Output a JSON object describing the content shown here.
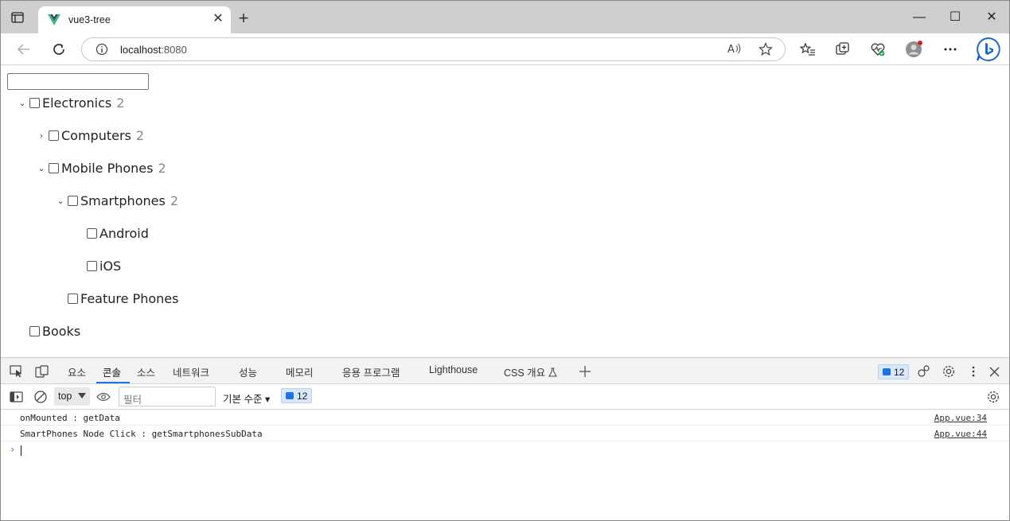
{
  "browser": {
    "tab_title": "vue3-tree",
    "tab_close": "✕",
    "new_tab": "+",
    "window_controls": {
      "minimize": "—",
      "maximize": "☐",
      "close": "✕"
    },
    "address": {
      "host": "localhost",
      "port": ":8080"
    }
  },
  "page": {
    "filter_value": "",
    "tree": [
      {
        "label": "Electronics",
        "count": "2",
        "arrow": "⌄",
        "checked": false
      },
      {
        "label": "Computers",
        "count": "2",
        "arrow": "›",
        "checked": false
      },
      {
        "label": "Mobile Phones",
        "count": "2",
        "arrow": "⌄",
        "checked": false
      },
      {
        "label": "Smartphones",
        "count": "2",
        "arrow": "⌄",
        "checked": false
      },
      {
        "label": "Android",
        "count": "",
        "arrow": "",
        "checked": false
      },
      {
        "label": "iOS",
        "count": "",
        "arrow": "",
        "checked": false
      },
      {
        "label": "Feature Phones",
        "count": "",
        "arrow": "",
        "checked": false
      },
      {
        "label": "Books",
        "count": "",
        "arrow": "",
        "checked": false
      }
    ]
  },
  "devtools": {
    "tabs": [
      "요소",
      "콘솔",
      "소스",
      "네트워크",
      "성능",
      "메모리",
      "응용 프로그램",
      "Lighthouse",
      "CSS 개요"
    ],
    "active_tab": "콘솔",
    "issues_count": "12",
    "context": "top",
    "filter_placeholder": "필터",
    "level": "기본 수준",
    "level_caret": "▾",
    "toolbar_issues": "12",
    "logs": [
      {
        "message": "onMounted : getData",
        "source": "App.vue:34"
      },
      {
        "message": "SmartPhones Node Click : getSmartphonesSubData",
        "source": "App.vue:44"
      }
    ],
    "prompt": "›"
  }
}
